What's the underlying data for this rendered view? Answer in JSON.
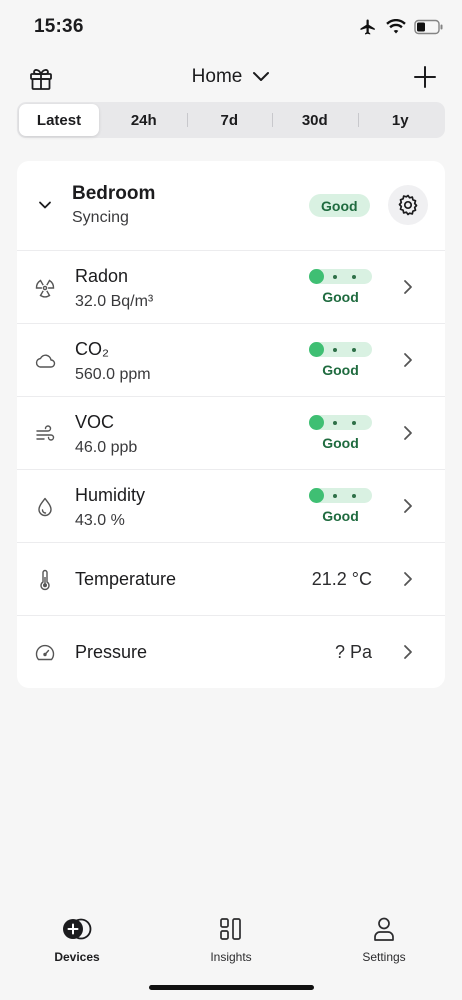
{
  "status_bar": {
    "time": "15:36"
  },
  "header": {
    "home_title": "Home"
  },
  "time_ranges": [
    "Latest",
    "24h",
    "7d",
    "30d",
    "1y"
  ],
  "device": {
    "name": "Bedroom",
    "status": "Syncing",
    "badge": "Good"
  },
  "sensors": [
    {
      "name": "Radon",
      "value": "32.0 Bq/m³",
      "rating": "Good",
      "icon": "radiation-icon"
    },
    {
      "name": "CO₂",
      "value": "560.0 ppm",
      "rating": "Good",
      "icon": "cloud-icon"
    },
    {
      "name": "VOC",
      "value": "46.0 ppb",
      "rating": "Good",
      "icon": "wind-icon"
    },
    {
      "name": "Humidity",
      "value": "43.0 %",
      "rating": "Good",
      "icon": "droplet-icon"
    },
    {
      "name": "Temperature",
      "value": "21.2 °C",
      "icon": "thermometer-icon"
    },
    {
      "name": "Pressure",
      "value": "? Pa",
      "icon": "gauge-icon"
    }
  ],
  "tabbar": {
    "devices": "Devices",
    "insights": "Insights",
    "settings": "Settings"
  },
  "colors": {
    "good_bg": "#d9f1e2",
    "good_text": "#1f6b3f",
    "good_dot": "#3fbf73"
  }
}
